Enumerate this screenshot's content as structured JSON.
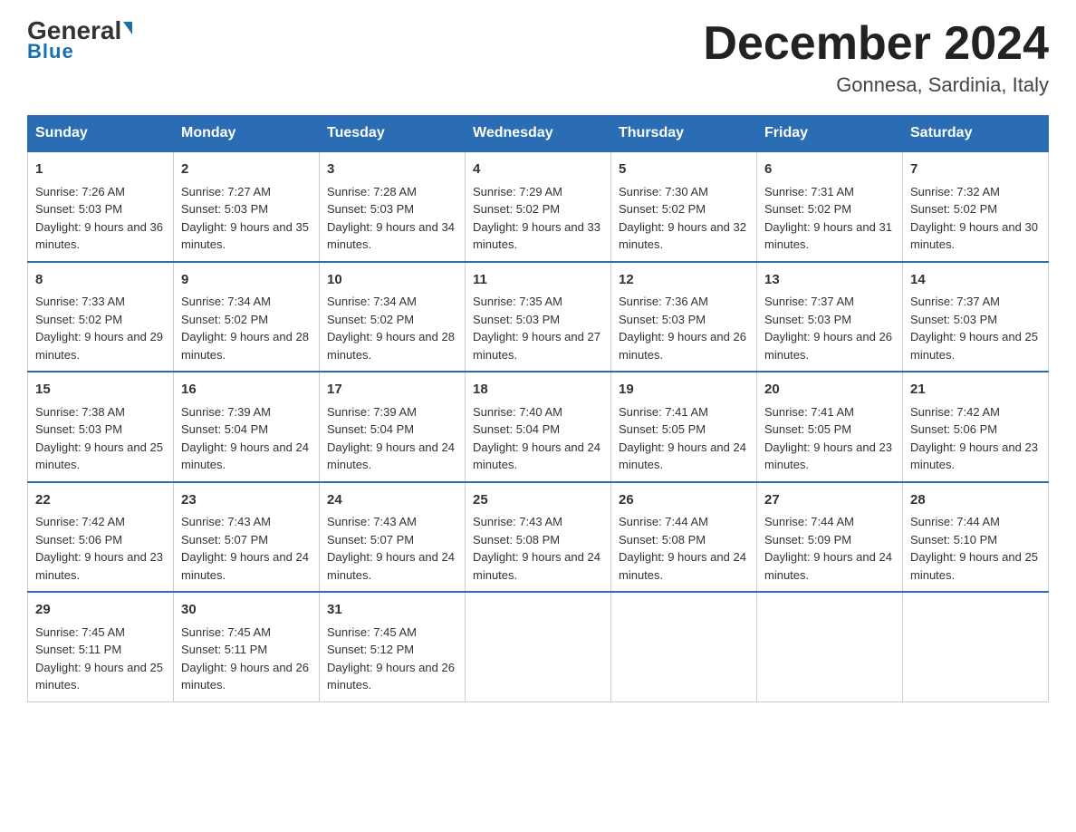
{
  "header": {
    "logo_general": "General",
    "logo_blue": "Blue",
    "month_title": "December 2024",
    "location": "Gonnesa, Sardinia, Italy"
  },
  "days": [
    "Sunday",
    "Monday",
    "Tuesday",
    "Wednesday",
    "Thursday",
    "Friday",
    "Saturday"
  ],
  "weeks": [
    [
      {
        "day": "1",
        "sunrise": "7:26 AM",
        "sunset": "5:03 PM",
        "daylight": "9 hours and 36 minutes."
      },
      {
        "day": "2",
        "sunrise": "7:27 AM",
        "sunset": "5:03 PM",
        "daylight": "9 hours and 35 minutes."
      },
      {
        "day": "3",
        "sunrise": "7:28 AM",
        "sunset": "5:03 PM",
        "daylight": "9 hours and 34 minutes."
      },
      {
        "day": "4",
        "sunrise": "7:29 AM",
        "sunset": "5:02 PM",
        "daylight": "9 hours and 33 minutes."
      },
      {
        "day": "5",
        "sunrise": "7:30 AM",
        "sunset": "5:02 PM",
        "daylight": "9 hours and 32 minutes."
      },
      {
        "day": "6",
        "sunrise": "7:31 AM",
        "sunset": "5:02 PM",
        "daylight": "9 hours and 31 minutes."
      },
      {
        "day": "7",
        "sunrise": "7:32 AM",
        "sunset": "5:02 PM",
        "daylight": "9 hours and 30 minutes."
      }
    ],
    [
      {
        "day": "8",
        "sunrise": "7:33 AM",
        "sunset": "5:02 PM",
        "daylight": "9 hours and 29 minutes."
      },
      {
        "day": "9",
        "sunrise": "7:34 AM",
        "sunset": "5:02 PM",
        "daylight": "9 hours and 28 minutes."
      },
      {
        "day": "10",
        "sunrise": "7:34 AM",
        "sunset": "5:02 PM",
        "daylight": "9 hours and 28 minutes."
      },
      {
        "day": "11",
        "sunrise": "7:35 AM",
        "sunset": "5:03 PM",
        "daylight": "9 hours and 27 minutes."
      },
      {
        "day": "12",
        "sunrise": "7:36 AM",
        "sunset": "5:03 PM",
        "daylight": "9 hours and 26 minutes."
      },
      {
        "day": "13",
        "sunrise": "7:37 AM",
        "sunset": "5:03 PM",
        "daylight": "9 hours and 26 minutes."
      },
      {
        "day": "14",
        "sunrise": "7:37 AM",
        "sunset": "5:03 PM",
        "daylight": "9 hours and 25 minutes."
      }
    ],
    [
      {
        "day": "15",
        "sunrise": "7:38 AM",
        "sunset": "5:03 PM",
        "daylight": "9 hours and 25 minutes."
      },
      {
        "day": "16",
        "sunrise": "7:39 AM",
        "sunset": "5:04 PM",
        "daylight": "9 hours and 24 minutes."
      },
      {
        "day": "17",
        "sunrise": "7:39 AM",
        "sunset": "5:04 PM",
        "daylight": "9 hours and 24 minutes."
      },
      {
        "day": "18",
        "sunrise": "7:40 AM",
        "sunset": "5:04 PM",
        "daylight": "9 hours and 24 minutes."
      },
      {
        "day": "19",
        "sunrise": "7:41 AM",
        "sunset": "5:05 PM",
        "daylight": "9 hours and 24 minutes."
      },
      {
        "day": "20",
        "sunrise": "7:41 AM",
        "sunset": "5:05 PM",
        "daylight": "9 hours and 23 minutes."
      },
      {
        "day": "21",
        "sunrise": "7:42 AM",
        "sunset": "5:06 PM",
        "daylight": "9 hours and 23 minutes."
      }
    ],
    [
      {
        "day": "22",
        "sunrise": "7:42 AM",
        "sunset": "5:06 PM",
        "daylight": "9 hours and 23 minutes."
      },
      {
        "day": "23",
        "sunrise": "7:43 AM",
        "sunset": "5:07 PM",
        "daylight": "9 hours and 24 minutes."
      },
      {
        "day": "24",
        "sunrise": "7:43 AM",
        "sunset": "5:07 PM",
        "daylight": "9 hours and 24 minutes."
      },
      {
        "day": "25",
        "sunrise": "7:43 AM",
        "sunset": "5:08 PM",
        "daylight": "9 hours and 24 minutes."
      },
      {
        "day": "26",
        "sunrise": "7:44 AM",
        "sunset": "5:08 PM",
        "daylight": "9 hours and 24 minutes."
      },
      {
        "day": "27",
        "sunrise": "7:44 AM",
        "sunset": "5:09 PM",
        "daylight": "9 hours and 24 minutes."
      },
      {
        "day": "28",
        "sunrise": "7:44 AM",
        "sunset": "5:10 PM",
        "daylight": "9 hours and 25 minutes."
      }
    ],
    [
      {
        "day": "29",
        "sunrise": "7:45 AM",
        "sunset": "5:11 PM",
        "daylight": "9 hours and 25 minutes."
      },
      {
        "day": "30",
        "sunrise": "7:45 AM",
        "sunset": "5:11 PM",
        "daylight": "9 hours and 26 minutes."
      },
      {
        "day": "31",
        "sunrise": "7:45 AM",
        "sunset": "5:12 PM",
        "daylight": "9 hours and 26 minutes."
      },
      null,
      null,
      null,
      null
    ]
  ]
}
